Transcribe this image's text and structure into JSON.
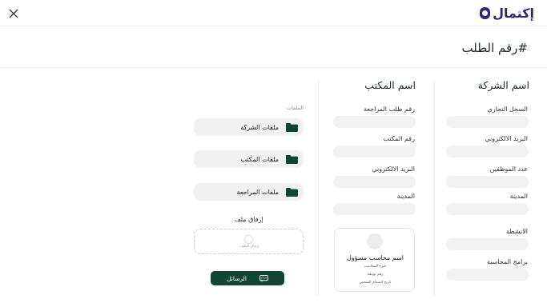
{
  "header": {
    "logo_text": "إكتمال",
    "close_icon": "close-icon"
  },
  "page": {
    "title": "#رقم الطلب"
  },
  "company": {
    "heading": "اسم الشركة",
    "fields": [
      {
        "label": "السجل التجاري",
        "value": ""
      },
      {
        "label": "البريد الالكتروني",
        "value": ""
      },
      {
        "label": "عدد الموظفين",
        "value": ""
      },
      {
        "label": "المدينة",
        "value": ""
      },
      {
        "label": "الانشطة",
        "value": ""
      },
      {
        "label": "برامج المحاسبة",
        "value": ""
      }
    ]
  },
  "office": {
    "heading": "اسم المكتب",
    "fields": [
      {
        "label": "رقم طلب المراجعة",
        "value": ""
      },
      {
        "label": "رقم المكتب",
        "value": ""
      },
      {
        "label": "البريد الالكتروني",
        "value": ""
      },
      {
        "label": "المدينة",
        "value": ""
      }
    ],
    "accountant": {
      "name": "اسم محاسب مسؤول",
      "line1": "خبرة المحاسب",
      "line2": "رقم توثيقة",
      "line3": "تاريخ انضمام الشخص"
    }
  },
  "files": {
    "title": "الملفات",
    "items": [
      {
        "label": "ملفات الشركة",
        "icon": "folder-icon"
      },
      {
        "label": "ملفات المكتب",
        "icon": "folder-icon"
      },
      {
        "label": "ملفات المراجعة",
        "icon": "folder-icon"
      }
    ],
    "attach_title": "إرفاق ملف",
    "drop_text": "إرفاق الملف",
    "messages_button": "الرسائل",
    "messages_icon": "chat-icon"
  },
  "colors": {
    "primary_green": "#0f4730",
    "logo_purple": "#2a2674",
    "field_gray": "#f2f2f2"
  }
}
